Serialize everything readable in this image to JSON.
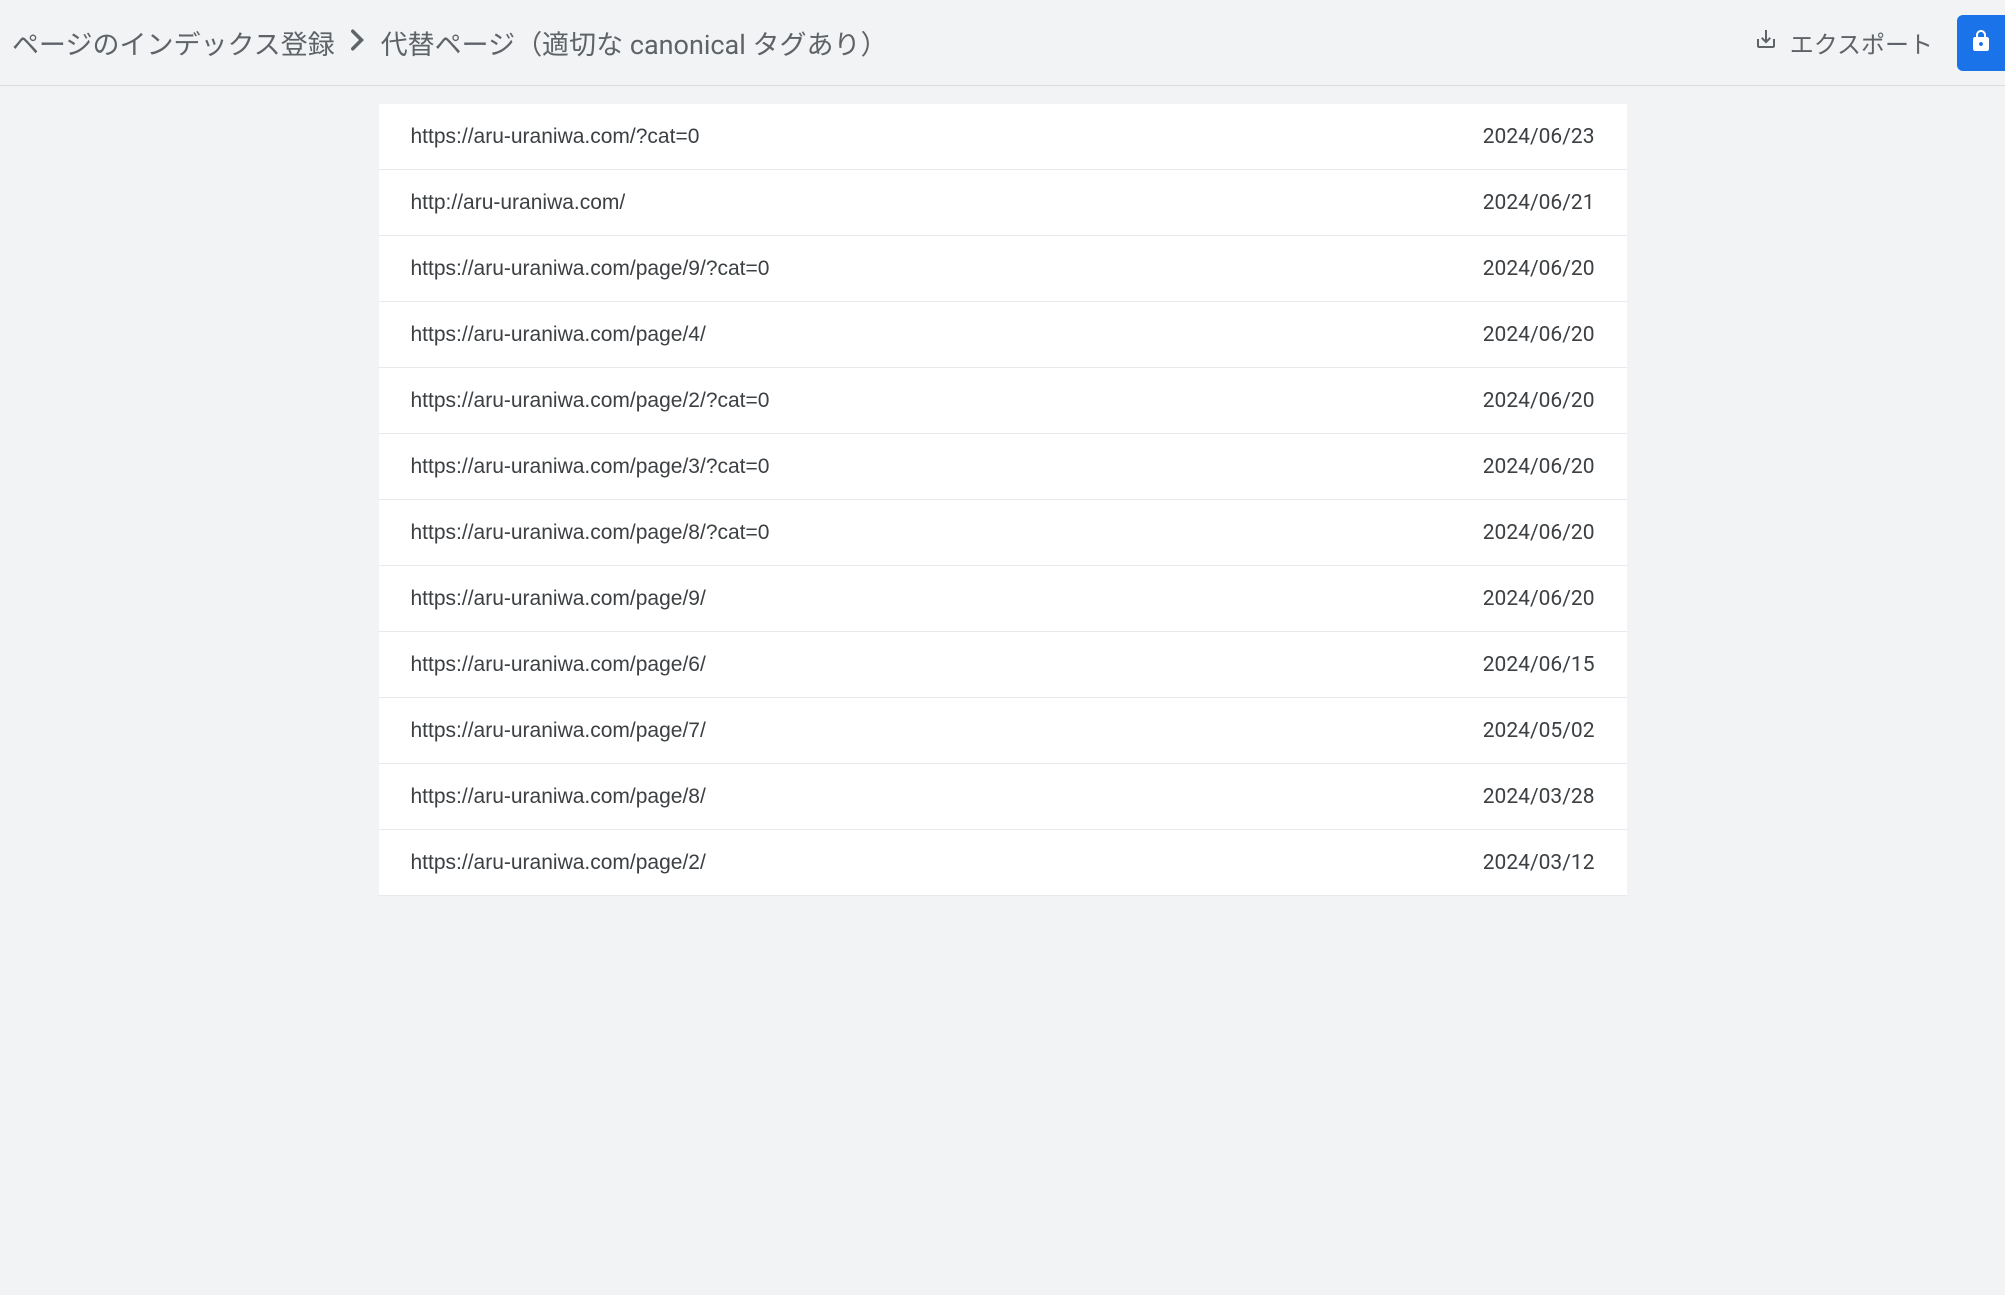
{
  "header": {
    "breadcrumb": {
      "parent": "ページのインデックス登録",
      "current": "代替ページ（適切な canonical タグあり）"
    },
    "export_label": "エクスポート"
  },
  "table": {
    "rows": [
      {
        "url": "https://aru-uraniwa.com/?cat=0",
        "date": "2024/06/23"
      },
      {
        "url": "http://aru-uraniwa.com/",
        "date": "2024/06/21"
      },
      {
        "url": "https://aru-uraniwa.com/page/9/?cat=0",
        "date": "2024/06/20"
      },
      {
        "url": "https://aru-uraniwa.com/page/4/",
        "date": "2024/06/20"
      },
      {
        "url": "https://aru-uraniwa.com/page/2/?cat=0",
        "date": "2024/06/20"
      },
      {
        "url": "https://aru-uraniwa.com/page/3/?cat=0",
        "date": "2024/06/20"
      },
      {
        "url": "https://aru-uraniwa.com/page/8/?cat=0",
        "date": "2024/06/20"
      },
      {
        "url": "https://aru-uraniwa.com/page/9/",
        "date": "2024/06/20"
      },
      {
        "url": "https://aru-uraniwa.com/page/6/",
        "date": "2024/06/15"
      },
      {
        "url": "https://aru-uraniwa.com/page/7/",
        "date": "2024/05/02"
      },
      {
        "url": "https://aru-uraniwa.com/page/8/",
        "date": "2024/03/28"
      },
      {
        "url": "https://aru-uraniwa.com/page/2/",
        "date": "2024/03/12"
      }
    ]
  }
}
